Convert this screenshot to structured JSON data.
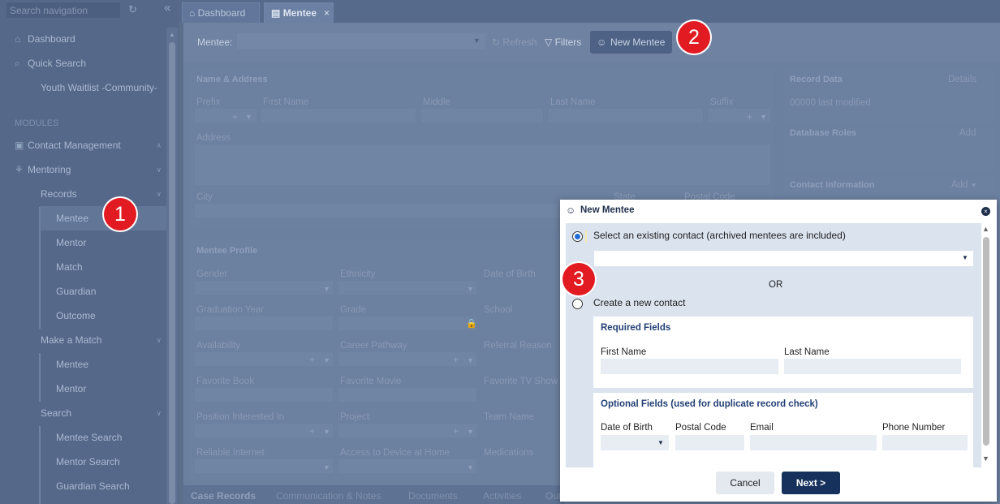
{
  "sidebar": {
    "search_placeholder": "Search navigation",
    "items": {
      "dashboard": "Dashboard",
      "quick_search": "Quick Search",
      "youth_waitlist": "Youth Waitlist -Community-",
      "modules_header": "MODULES",
      "contact_management": "Contact Management",
      "mentoring": "Mentoring",
      "records": "Records",
      "records_mentee": "Mentee",
      "records_mentor": "Mentor",
      "records_match": "Match",
      "records_guardian": "Guardian",
      "records_outcome": "Outcome",
      "make_a_match": "Make a Match",
      "mam_mentee": "Mentee",
      "mam_mentor": "Mentor",
      "search": "Search",
      "mentee_search": "Mentee Search",
      "mentor_search": "Mentor Search",
      "guardian_search": "Guardian Search"
    }
  },
  "tabs": {
    "dashboard": "Dashboard",
    "mentee": "Mentee"
  },
  "toolbar": {
    "mentee_label": "Mentee:",
    "refresh": "Refresh",
    "filters": "Filters",
    "new_mentee": "New Mentee"
  },
  "name_address": {
    "header": "Name & Address",
    "prefix": "Prefix",
    "first_name": "First Name",
    "middle": "Middle",
    "last_name": "Last Name",
    "suffix": "Suffix",
    "address": "Address",
    "city": "City",
    "state": "State",
    "postal_code": "Postal Code"
  },
  "record_data": {
    "header": "Record Data",
    "details": "Details",
    "last_modified": "00000 last modified",
    "db_roles": "Database Roles",
    "add": "Add",
    "contact_info": "Contact Information",
    "add_dropdown": "Add"
  },
  "mentee_profile": {
    "header": "Mentee Profile",
    "gender": "Gender",
    "ethnicity": "Ethnicity",
    "dob": "Date of Birth",
    "grad_year": "Graduation Year",
    "grade": "Grade",
    "school": "School",
    "availability": "Availability",
    "career": "Career Pathway",
    "referral": "Referral Reason",
    "fav_book": "Favorite Book",
    "fav_movie": "Favorite Movie",
    "fav_tv": "Favorite TV Show",
    "position": "Position Interested In",
    "project": "Project",
    "team": "Team Name",
    "internet": "Reliable Internet",
    "device": "Access to Device at Home",
    "medications": "Medications"
  },
  "bottom_tabs": {
    "case_records": "Case Records",
    "communication": "Communication & Notes",
    "documents": "Documents",
    "activities": "Activities",
    "out": "Out"
  },
  "badges": {
    "one": "1",
    "two": "2",
    "three": "3"
  },
  "modal": {
    "title": "New Mentee",
    "existing_label": "Select an existing contact (archived mentees are included)",
    "or": "OR",
    "create_label": "Create a new contact",
    "required_header": "Required Fields",
    "first_name": "First Name",
    "last_name": "Last Name",
    "optional_header": "Optional Fields (used for duplicate record check)",
    "dob": "Date of Birth",
    "postal_code": "Postal Code",
    "email": "Email",
    "phone": "Phone Number",
    "cancel": "Cancel",
    "next": "Next >"
  },
  "colors": {
    "accent": "#16325c",
    "badge": "#e21a22",
    "radio_selected": "#1e6bd6"
  }
}
